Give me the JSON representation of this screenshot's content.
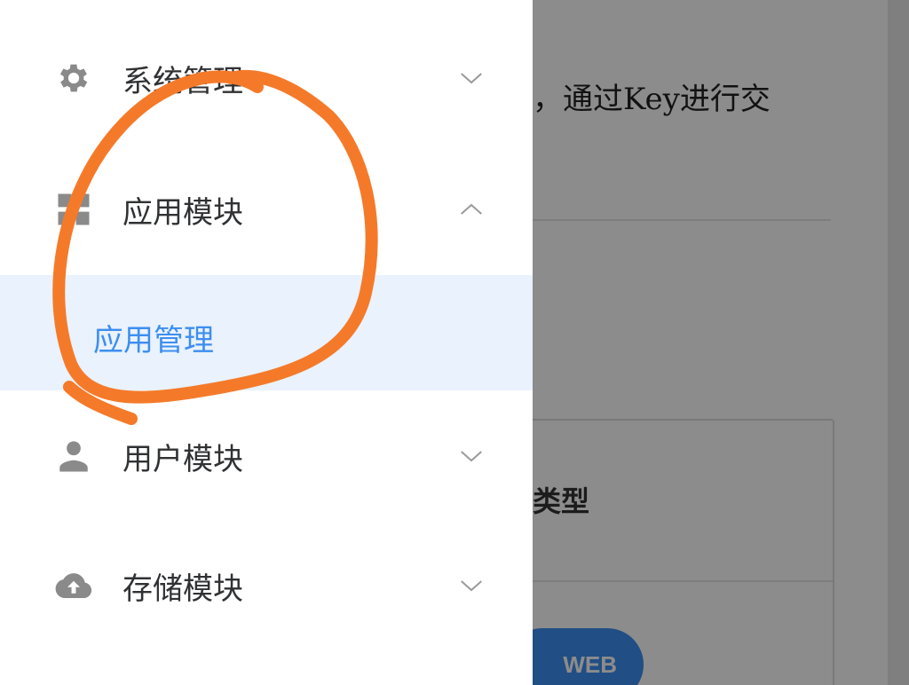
{
  "background_page": {
    "intro_text_fragment": "，通过Key进行交",
    "card_title_fragment": "类型",
    "web_button_label": "WEB"
  },
  "drawer": {
    "items": [
      {
        "label": "系统管理",
        "icon": "gear-icon",
        "expanded": false
      },
      {
        "label": "应用模块",
        "icon": "grid-icon",
        "expanded": true
      },
      {
        "label": "用户模块",
        "icon": "user-icon",
        "expanded": false
      },
      {
        "label": "存储模块",
        "icon": "cloud-upload-icon",
        "expanded": false
      }
    ],
    "active_subitem": {
      "label": "应用管理"
    }
  },
  "colors": {
    "accent": "#3d8ef0",
    "active_background": "#e9f2fd",
    "icon_gray": "#8a8a8a",
    "annotation_stroke": "#f47a2a"
  }
}
